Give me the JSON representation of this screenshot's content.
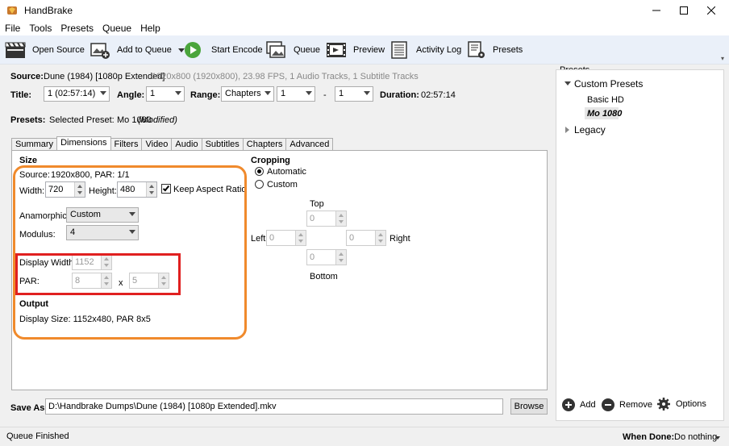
{
  "window": {
    "title": "HandBrake"
  },
  "menu": [
    "File",
    "Tools",
    "Presets",
    "Queue",
    "Help"
  ],
  "toolbar": {
    "open_source": "Open Source",
    "add_to_queue": "Add to Queue",
    "start_encode": "Start Encode",
    "queue": "Queue",
    "preview": "Preview",
    "activity_log": "Activity Log",
    "presets": "Presets"
  },
  "source": {
    "label": "Source:",
    "name": "Dune (1984) [1080p Extended]",
    "info": "1920x800 (1920x800), 23.98 FPS, 1 Audio Tracks, 1 Subtitle Tracks"
  },
  "title_row": {
    "title_label": "Title:",
    "title_value": "1 (02:57:14)",
    "angle_label": "Angle:",
    "angle_value": "1",
    "range_label": "Range:",
    "range_type": "Chapters",
    "range_start": "1",
    "range_sep": "-",
    "range_end": "1",
    "duration_label": "Duration:",
    "duration_value": "02:57:14"
  },
  "presets_row": {
    "label": "Presets:",
    "selected_prefix": "Selected Preset:",
    "selected_name": "Mo 1080",
    "modified": "(Modified)"
  },
  "tabs": [
    "Summary",
    "Dimensions",
    "Filters",
    "Video",
    "Audio",
    "Subtitles",
    "Chapters",
    "Advanced"
  ],
  "active_tab": "Dimensions",
  "size": {
    "heading": "Size",
    "source_label": "Source:",
    "source_value": "1920x800, PAR: 1/1",
    "width_label": "Width:",
    "width_value": "720",
    "height_label": "Height:",
    "height_value": "480",
    "keep_aspect_label": "Keep Aspect Ratio",
    "keep_aspect_checked": true,
    "anamorphic_label": "Anamorphic:",
    "anamorphic_value": "Custom",
    "modulus_label": "Modulus:",
    "modulus_value": "4",
    "display_width_label": "Display Width:",
    "display_width_value": "1152",
    "par_label": "PAR:",
    "par_x": "8",
    "par_sep": "x",
    "par_y": "5"
  },
  "output": {
    "heading": "Output",
    "display_size": "Display Size: 1152x480,  PAR 8x5"
  },
  "cropping": {
    "heading": "Cropping",
    "automatic_label": "Automatic",
    "custom_label": "Custom",
    "selected": "Automatic",
    "top_label": "Top",
    "top_value": "0",
    "left_label": "Left",
    "left_value": "0",
    "right_label": "Right",
    "right_value": "0",
    "bottom_label": "Bottom",
    "bottom_value": "0"
  },
  "save_as": {
    "label": "Save As:",
    "path": "D:\\Handbrake Dumps\\Dune (1984) [1080p Extended].mkv",
    "browse": "Browse"
  },
  "preset_panel": {
    "heading": "Presets",
    "groups": [
      {
        "name": "Custom Presets",
        "expanded": true,
        "items": [
          "Basic HD",
          "Mo 1080"
        ]
      },
      {
        "name": "Legacy",
        "expanded": false,
        "items": []
      }
    ],
    "selected_item": "Mo 1080",
    "add": "Add",
    "remove": "Remove",
    "options": "Options"
  },
  "status": {
    "text": "Queue Finished",
    "when_done_label": "When Done:",
    "when_done_value": "Do nothing"
  },
  "colors": {
    "highlight_orange": "#f08a2c",
    "highlight_red": "#e02020",
    "start_green": "#4aa53c",
    "toolbar_bg": "#eaf0f9"
  }
}
